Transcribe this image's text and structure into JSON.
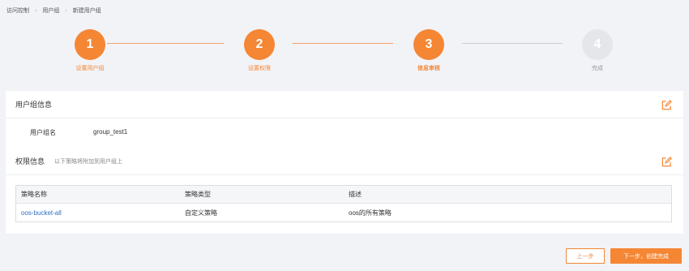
{
  "breadcrumb": [
    "访问控制",
    "用户组",
    "新建用户组"
  ],
  "steps": [
    {
      "number": "1",
      "label": "设置用户组",
      "state": "done"
    },
    {
      "number": "2",
      "label": "设置权限",
      "state": "done"
    },
    {
      "number": "3",
      "label": "信息审核",
      "state": "current"
    },
    {
      "number": "4",
      "label": "完成",
      "state": "pending"
    }
  ],
  "group_info": {
    "title": "用户组信息",
    "name_label": "用户组名",
    "name_value": "group_test1"
  },
  "permission_info": {
    "title": "权限信息",
    "hint": "以下策略将附加到用户组上",
    "table": {
      "headers": [
        "策略名称",
        "策略类型",
        "描述"
      ],
      "rows": [
        {
          "name": "oos-bucket-all",
          "type": "自定义策略",
          "desc": "oos的所有策略"
        }
      ]
    }
  },
  "buttons": {
    "prev": "上一步",
    "next": "下一步，创建完成"
  },
  "colors": {
    "accent": "#f58634",
    "link": "#2f6fc6",
    "pending": "#e5e6ea"
  }
}
